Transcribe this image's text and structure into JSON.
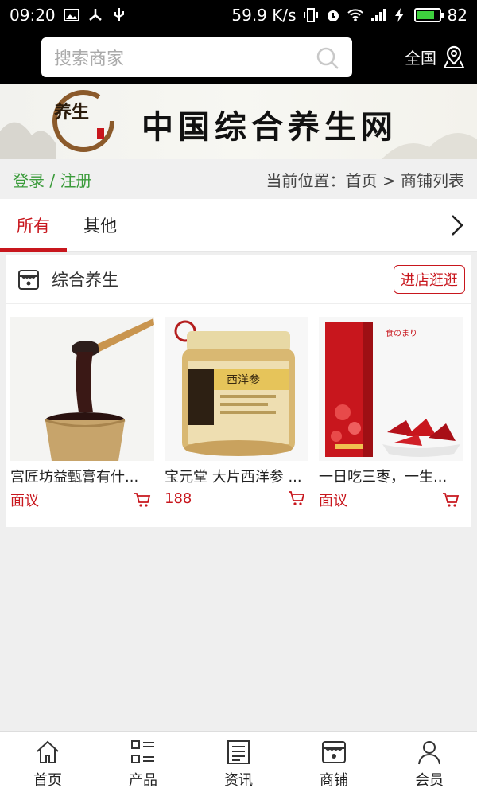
{
  "status_bar": {
    "time": "09:20",
    "net_speed": "59.9 K/s",
    "battery": "82",
    "battery_level": 0.82,
    "signal": "4G"
  },
  "header": {
    "search_placeholder": "搜索商家",
    "region_label": "全国"
  },
  "banner": {
    "title": "中国综合养生网",
    "logo_text": "养生"
  },
  "breadcrumb": {
    "login_link": "登录 / 注册",
    "location": "当前位置：首页 > 商铺列表"
  },
  "tabs": [
    {
      "label": "所有",
      "active": true
    },
    {
      "label": "其他",
      "active": false
    }
  ],
  "shop": {
    "name": "综合养生",
    "visit_button": "进店逛逛",
    "products": [
      {
        "name": "宫匠坊益甄膏有什...",
        "price": "面议"
      },
      {
        "name": "宝元堂 大片西洋参 ...",
        "price": "188"
      },
      {
        "name": "一日吃三枣，一生...",
        "price": "面议"
      }
    ]
  },
  "bottom_nav": [
    {
      "label": "首页",
      "icon": "home-icon"
    },
    {
      "label": "产品",
      "icon": "grid-list-icon"
    },
    {
      "label": "资讯",
      "icon": "news-icon"
    },
    {
      "label": "商铺",
      "icon": "store-icon"
    },
    {
      "label": "会员",
      "icon": "user-icon"
    }
  ],
  "colors": {
    "accent": "#c8161d",
    "login_green": "#3b9b3b",
    "header_bg": "#000000"
  }
}
